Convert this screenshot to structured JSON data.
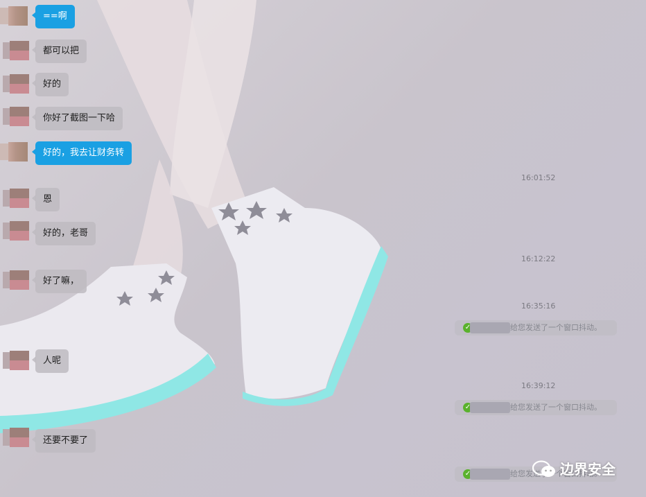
{
  "messages": [
    {
      "text": "==啊",
      "style": "blue"
    },
    {
      "text": "都可以把",
      "style": "gray"
    },
    {
      "text": "好的",
      "style": "gray"
    },
    {
      "text": "你好了截图一下哈",
      "style": "gray"
    },
    {
      "text": "好的，我去让财务转",
      "style": "blue"
    },
    {
      "text": "恩",
      "style": "gray"
    },
    {
      "text": "好的，老哥",
      "style": "gray"
    },
    {
      "text": "好了嘛，",
      "style": "gray"
    },
    {
      "text": "人呢",
      "style": "gray"
    },
    {
      "text": "还要不要了",
      "style": "gray"
    }
  ],
  "timestamps": [
    "16:01:52",
    "16:12:22",
    "16:35:16",
    "16:39:12"
  ],
  "shake_notice_text": "给您发送了一个窗口抖动。",
  "watermark": {
    "text": "边界安全",
    "icon": "wechat-icon"
  },
  "colors": {
    "blue_bubble": "#1aa0e3",
    "gray_bubble": "#bebbc1",
    "check": "#5ab22c"
  }
}
